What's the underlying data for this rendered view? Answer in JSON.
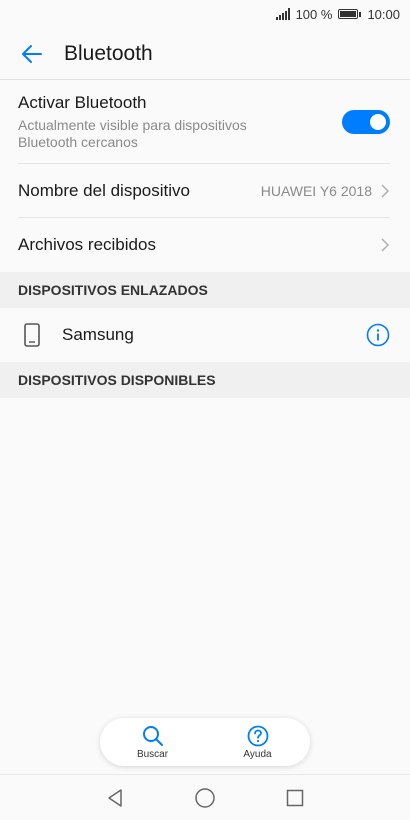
{
  "status_bar": {
    "battery_text": "100 %",
    "time": "10:00"
  },
  "header": {
    "title": "Bluetooth"
  },
  "bluetooth": {
    "title": "Activar Bluetooth",
    "subtitle": "Actualmente visible para dispositivos Bluetooth cercanos",
    "enabled": true
  },
  "device_name_row": {
    "label": "Nombre del dispositivo",
    "value": "HUAWEI Y6 2018"
  },
  "received_files_row": {
    "label": "Archivos recibidos"
  },
  "sections": {
    "linked": "DISPOSITIVOS ENLAZADOS",
    "available": "DISPOSITIVOS DISPONIBLES"
  },
  "linked_devices": [
    {
      "name": "Samsung",
      "icon": "phone-icon"
    }
  ],
  "action_bar": {
    "search_label": "Buscar",
    "help_label": "Ayuda"
  },
  "colors": {
    "accent": "#007dff",
    "background": "#fafafa",
    "section": "#f0f0f0"
  }
}
